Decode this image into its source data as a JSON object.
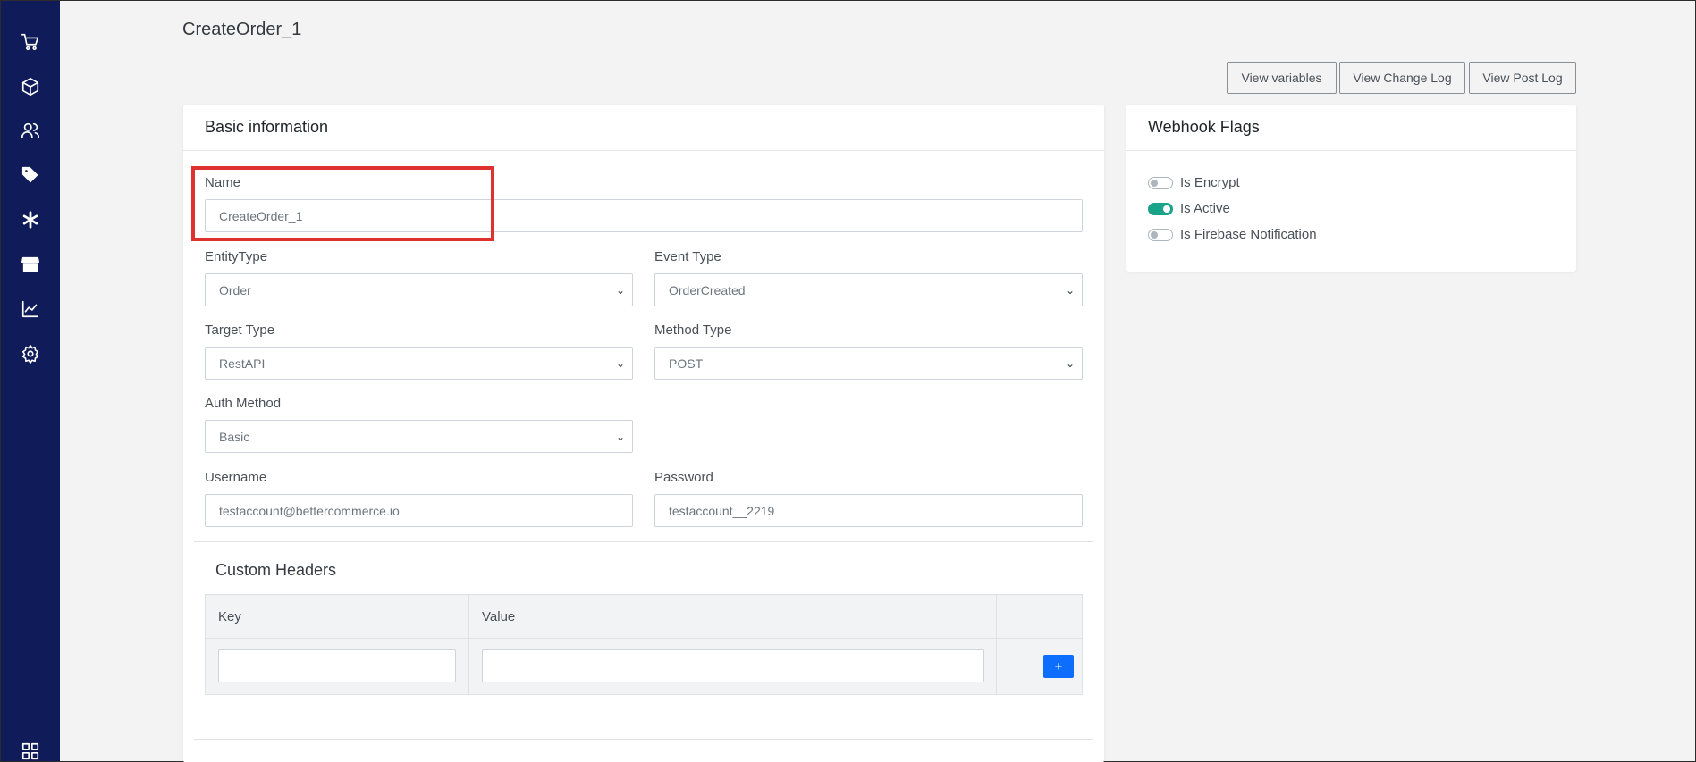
{
  "sidebar": {
    "items": [
      {
        "icon": "cart-icon"
      },
      {
        "icon": "box-icon"
      },
      {
        "icon": "users-icon"
      },
      {
        "icon": "tags-icon"
      },
      {
        "icon": "asterisk-icon"
      },
      {
        "icon": "store-icon"
      },
      {
        "icon": "chart-line-icon"
      },
      {
        "icon": "gear-icon"
      }
    ],
    "bottom_icon": "grid-icon",
    "bg_color": "#101c59"
  },
  "page": {
    "title": "CreateOrder_1"
  },
  "header_buttons": {
    "view_variables": "View variables",
    "view_change_log": "View Change Log",
    "view_post_log": "View Post Log"
  },
  "basic_info": {
    "title": "Basic information",
    "name_label": "Name",
    "name_value": "CreateOrder_1",
    "entity_type_label": "EntityType",
    "entity_type_value": "Order",
    "event_type_label": "Event Type",
    "event_type_value": "OrderCreated",
    "target_type_label": "Target Type",
    "target_type_value": "RestAPI",
    "method_type_label": "Method Type",
    "method_type_value": "POST",
    "auth_method_label": "Auth Method",
    "auth_method_value": "Basic",
    "username_label": "Username",
    "username_value": "testaccount@bettercommerce.io",
    "password_label": "Password",
    "password_value": "testaccount__2219"
  },
  "custom_headers": {
    "title": "Custom Headers",
    "col_key": "Key",
    "col_value": "Value",
    "add_label": "+"
  },
  "webhook_flags": {
    "title": "Webhook Flags",
    "flags": [
      {
        "label": "Is Encrypt",
        "on": false
      },
      {
        "label": "Is Active",
        "on": true
      },
      {
        "label": "Is Firebase Notification",
        "on": false
      }
    ],
    "active_color": "#1aa389"
  }
}
